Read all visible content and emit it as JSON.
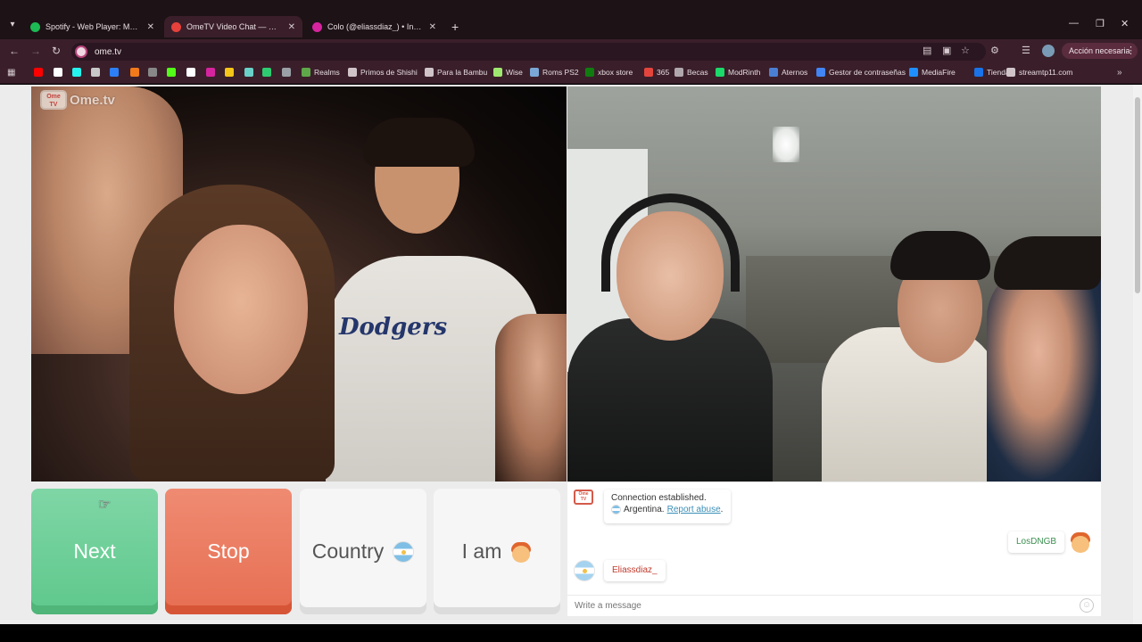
{
  "browser": {
    "tabs": [
      {
        "title": "Spotify - Web Player: Music for",
        "favicon_color": "#1db954",
        "active": false
      },
      {
        "title": "OmeTV Video Chat — Ome",
        "favicon_color": "#e8413c",
        "active": true
      },
      {
        "title": "Colo (@eliassdiaz_) • Instagram",
        "favicon_color": "#d6249f",
        "active": false
      }
    ],
    "url": "ome.tv",
    "action_button": "Acción necesaria",
    "bookmarks": [
      {
        "label": "",
        "icon_color": "#ff0000"
      },
      {
        "label": "",
        "icon_color": "#ffffff"
      },
      {
        "label": "",
        "icon_color": "#25f4ee"
      },
      {
        "label": "",
        "icon_color": "#c8c8c8"
      },
      {
        "label": "",
        "icon_color": "#2d7ff9"
      },
      {
        "label": "",
        "icon_color": "#f27a1a"
      },
      {
        "label": "",
        "icon_color": "#888888"
      },
      {
        "label": "",
        "icon_color": "#53fc18"
      },
      {
        "label": "",
        "icon_color": "#ffffff"
      },
      {
        "label": "",
        "icon_color": "#d6249f"
      },
      {
        "label": "",
        "icon_color": "#f5c518"
      },
      {
        "label": "",
        "icon_color": "#6ad1c9"
      },
      {
        "label": "",
        "icon_color": "#2ecc71"
      },
      {
        "label": "",
        "icon_color": "#9aa0a6"
      },
      {
        "label": "Realms",
        "icon_color": "#5fa84a"
      },
      {
        "label": "Primos de Shishi",
        "icon_color": "#d0c4c9"
      },
      {
        "label": "Para la Bambu",
        "icon_color": "#d0c4c9"
      },
      {
        "label": "Wise",
        "icon_color": "#9fe870"
      },
      {
        "label": "Roms PS2",
        "icon_color": "#7aa7d6"
      },
      {
        "label": "xbox store",
        "icon_color": "#107c10"
      },
      {
        "label": "365",
        "icon_color": "#e3453c"
      },
      {
        "label": "Becas",
        "icon_color": "#b0a8ad"
      },
      {
        "label": "ModRinth",
        "icon_color": "#1bd96a"
      },
      {
        "label": "Aternos",
        "icon_color": "#4a7fd4"
      },
      {
        "label": "Gestor de contraseñas",
        "icon_color": "#4285f4"
      },
      {
        "label": "MediaFire",
        "icon_color": "#1f8fff"
      },
      {
        "label": "Tienda",
        "icon_color": "#1a73e8"
      },
      {
        "label": "streamtp11.com",
        "icon_color": "#d0c4c9"
      }
    ]
  },
  "ometv": {
    "logo_text": "Ome.tv",
    "logo_badge": "Ome TV",
    "buttons": {
      "next": "Next",
      "stop": "Stop",
      "country": "Country",
      "iam": "I am"
    },
    "chat": {
      "system_line1": "Connection established.",
      "system_country": "Argentina.",
      "report_link": "Report abuse",
      "report_suffix": ".",
      "my_name": "LosDNGB",
      "partner_name": "Eliassdiaz_",
      "input_placeholder": "Write a message"
    }
  },
  "colors": {
    "next": "#5ec88b",
    "stop": "#e66e52",
    "link": "#3a8fb7"
  }
}
